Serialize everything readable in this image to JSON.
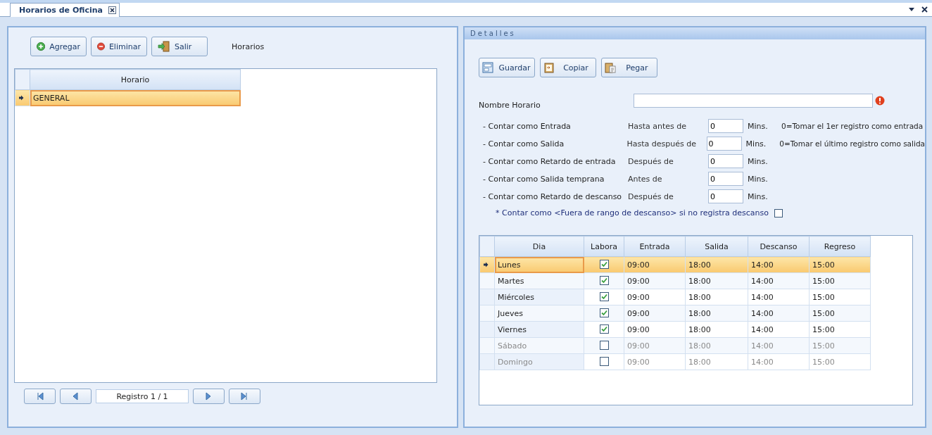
{
  "tab": {
    "title": "Horarios de Oficina",
    "selected": true
  },
  "left": {
    "buttons": [
      {
        "label": "Agregar",
        "kind": "add"
      },
      {
        "label": "Eliminar",
        "kind": "remove"
      },
      {
        "label": "Salir",
        "kind": "exit"
      }
    ],
    "caption": "Horarios",
    "grid": {
      "columns": [
        "Horario"
      ],
      "rows": [
        {
          "horario": "GENERAL",
          "selected": true
        }
      ]
    },
    "record": "Registro 1 / 1"
  },
  "right": {
    "title": "Detalles",
    "buttons": [
      {
        "label": "Guardar",
        "kind": "save"
      },
      {
        "label": "Copiar",
        "kind": "copy"
      },
      {
        "label": "Pegar",
        "kind": "paste"
      }
    ],
    "name_label": "Nombre Horario",
    "name_error": true,
    "rules": [
      {
        "label": "- Contar como Entrada",
        "condition": "Hasta antes de",
        "value": "0",
        "unit": "Mins.",
        "note": "0=Tomar el 1er registro como entrada"
      },
      {
        "label": "- Contar como Salida",
        "condition": "Hasta después de",
        "value": "0",
        "unit": "Mins.",
        "note": "0=Tomar el último registro como salida"
      },
      {
        "label": "- Contar como Retardo de entrada",
        "condition": "Después de",
        "value": "0",
        "unit": "Mins."
      },
      {
        "label": "- Contar como Salida temprana",
        "condition": "Antes de",
        "value": "0",
        "unit": "Mins."
      },
      {
        "label": "- Contar como Retardo de descanso",
        "condition": "Después de",
        "value": "0",
        "unit": "Mins."
      }
    ],
    "break_option": {
      "label": "* Contar como <Fuera de rango de descanso> si no registra descanso",
      "checked": false
    },
    "days": {
      "columns": [
        "Dia",
        "Labora",
        "Entrada",
        "Salida",
        "Descanso",
        "Regreso"
      ],
      "rows": [
        {
          "dia": "Lunes",
          "labora": true,
          "entrada": "09:00",
          "salida": "18:00",
          "descanso": "14:00",
          "regreso": "15:00",
          "selected": true
        },
        {
          "dia": "Martes",
          "labora": true,
          "entrada": "09:00",
          "salida": "18:00",
          "descanso": "14:00",
          "regreso": "15:00",
          "selected": false
        },
        {
          "dia": "Miércoles",
          "labora": true,
          "entrada": "09:00",
          "salida": "18:00",
          "descanso": "14:00",
          "regreso": "15:00",
          "selected": false
        },
        {
          "dia": "Jueves",
          "labora": true,
          "entrada": "09:00",
          "salida": "18:00",
          "descanso": "14:00",
          "regreso": "15:00",
          "selected": false
        },
        {
          "dia": "Viernes",
          "labora": true,
          "entrada": "09:00",
          "salida": "18:00",
          "descanso": "14:00",
          "regreso": "15:00",
          "selected": false
        },
        {
          "dia": "Sábado",
          "labora": false,
          "entrada": "09:00",
          "salida": "18:00",
          "descanso": "14:00",
          "regreso": "15:00",
          "selected": false
        },
        {
          "dia": "Domingo",
          "labora": false,
          "entrada": "09:00",
          "salida": "18:00",
          "descanso": "14:00",
          "regreso": "15:00",
          "selected": false
        }
      ]
    }
  }
}
